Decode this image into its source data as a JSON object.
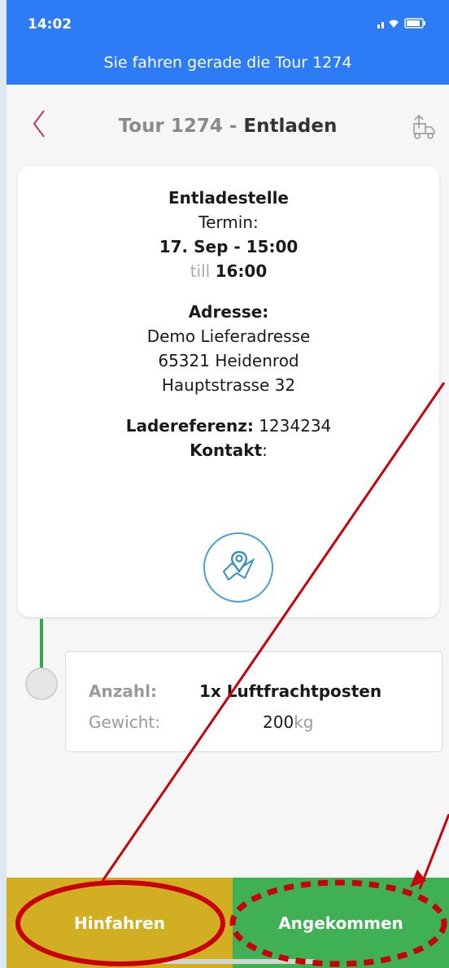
{
  "status_bar": {
    "time": "14:02",
    "icons": "wifi battery"
  },
  "banner": {
    "text": "Sie fahren gerade die Tour 1274"
  },
  "header": {
    "back_icon": "chevron-left",
    "title_prefix": "Tour 1274 - ",
    "title_main": "Entladen",
    "share_icon": "truck-upload"
  },
  "stop": {
    "heading": "Entladestelle",
    "termin_label": "Termin:",
    "date_time": "17. Sep - 15:00",
    "till_label": "till",
    "till_time": "16:00",
    "address_label": "Adresse:",
    "address_line1": "Demo Lieferadresse",
    "address_line2": "65321 Heidenrod",
    "address_line3": "Hauptstrasse 32",
    "ref_label": "Ladereferenz:",
    "ref_value": "1234234",
    "contact_label": "Kontakt",
    "contact_colon": ":",
    "map_icon": "map-pin"
  },
  "freight": {
    "count_label": "Anzahl:",
    "count_value": "1x Luftfrachtposten",
    "weight_label": "Gewicht:",
    "weight_value": "200",
    "weight_unit": "kg"
  },
  "actions": {
    "hinfahren": "Hinfahren",
    "angekommen": "Angekommen"
  },
  "colors": {
    "header_blue": "#2d7cf6",
    "hinfahren_yellow": "#d2ae22",
    "angekommen_green": "#3fb154",
    "annotation_red": "#c8000a"
  }
}
